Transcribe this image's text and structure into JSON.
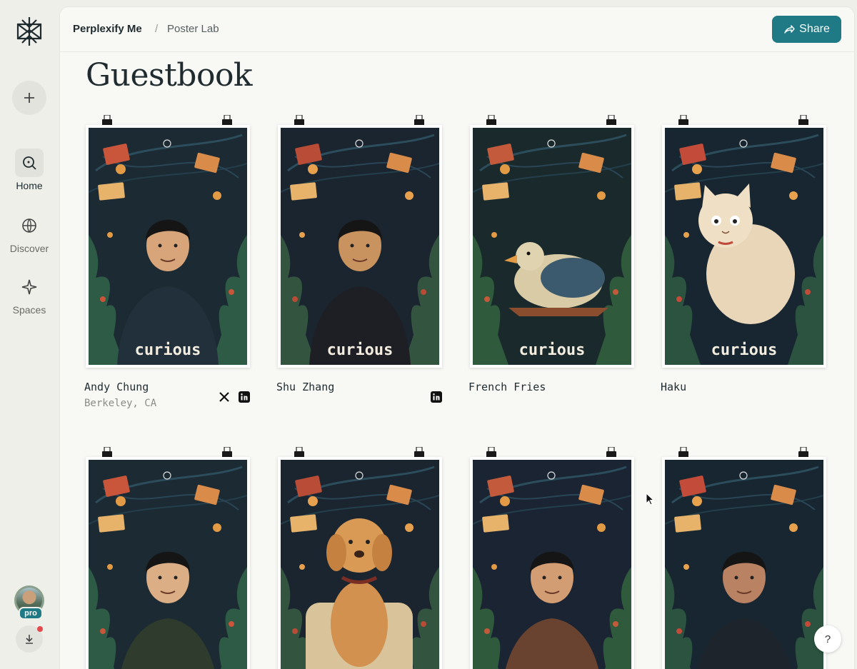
{
  "app": {
    "breadcrumb_root": "Perplexify Me",
    "breadcrumb_sep": "/",
    "breadcrumb_page": "Poster Lab"
  },
  "sidebar": {
    "items": [
      {
        "label": "Home",
        "icon": "search-icon",
        "active": true
      },
      {
        "label": "Discover",
        "icon": "globe-icon",
        "active": false
      },
      {
        "label": "Spaces",
        "icon": "sparkle-icon",
        "active": false
      }
    ],
    "avatar_badge": "pro"
  },
  "header": {
    "share_label": "Share"
  },
  "page": {
    "title": "Guestbook"
  },
  "posters": [
    {
      "name": "Andy Chung",
      "location": "Berkeley, CA",
      "socials": [
        "x-icon",
        "linkedin-icon"
      ],
      "wordmark": "curious"
    },
    {
      "name": "Shu Zhang",
      "location": "",
      "socials": [
        "linkedin-icon"
      ],
      "wordmark": "curious"
    },
    {
      "name": "French Fries",
      "location": "",
      "socials": [],
      "wordmark": "curious"
    },
    {
      "name": "Haku",
      "location": "",
      "socials": [],
      "wordmark": "curious"
    },
    {
      "name": "",
      "location": "",
      "socials": []
    },
    {
      "name": "",
      "location": "",
      "socials": []
    },
    {
      "name": "",
      "location": "",
      "socials": []
    },
    {
      "name": "",
      "location": "",
      "socials": []
    }
  ],
  "help": {
    "label": "?"
  },
  "colors": {
    "accent": "#1f7a86",
    "poster_bg": "#1b2a32",
    "text": "#1f2b2e"
  }
}
